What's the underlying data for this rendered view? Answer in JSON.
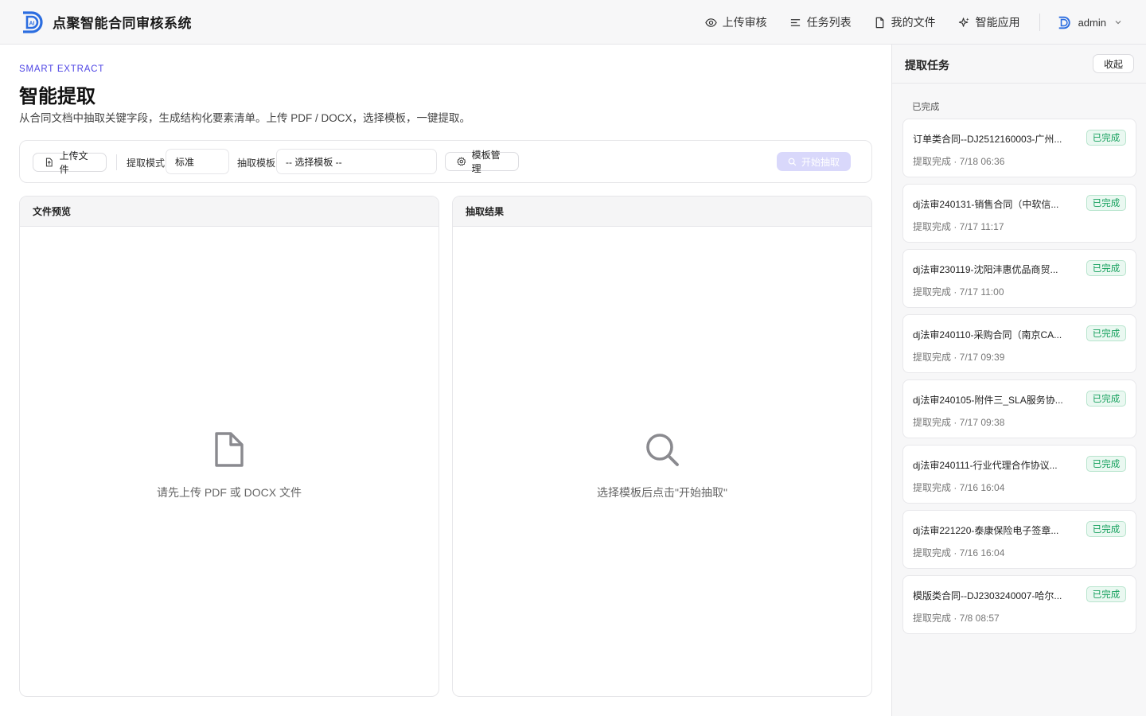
{
  "header": {
    "app_title": "点聚智能合同审核系统",
    "nav": [
      {
        "label": "上传审核",
        "icon": "eye-icon"
      },
      {
        "label": "任务列表",
        "icon": "list-icon"
      },
      {
        "label": "我的文件",
        "icon": "file-icon"
      },
      {
        "label": "智能应用",
        "icon": "sparkle-icon"
      }
    ],
    "user": {
      "name": "admin"
    }
  },
  "page": {
    "eyebrow": "SMART EXTRACT",
    "title": "智能提取",
    "description": "从合同文档中抽取关键字段，生成结构化要素清单。上传 PDF / DOCX，选择模板，一键提取。"
  },
  "toolbar": {
    "upload_label": "上传文件",
    "mode_label": "提取模式",
    "mode_value": "标准",
    "template_label": "抽取模板",
    "template_value": "-- 选择模板 --",
    "template_manage_label": "模板管理",
    "start_label": "开始抽取"
  },
  "panels": {
    "preview": {
      "title": "文件预览",
      "empty_text": "请先上传 PDF 或 DOCX 文件"
    },
    "result": {
      "title": "抽取结果",
      "empty_text": "选择模板后点击\"开始抽取\""
    }
  },
  "sidebar": {
    "title": "提取任务",
    "collapse_label": "收起",
    "group_label": "已完成",
    "tasks": [
      {
        "name": "订单类合同--DJ2512160003-广州...",
        "meta": "提取完成 · 7/18 06:36",
        "status": "已完成"
      },
      {
        "name": "dj法审240131-销售合同（中软信...",
        "meta": "提取完成 · 7/17 11:17",
        "status": "已完成"
      },
      {
        "name": "dj法审230119-沈阳沣惠优品商贸...",
        "meta": "提取完成 · 7/17 11:00",
        "status": "已完成"
      },
      {
        "name": "dj法审240110-采购合同（南京CA...",
        "meta": "提取完成 · 7/17 09:39",
        "status": "已完成"
      },
      {
        "name": "dj法审240105-附件三_SLA服务协...",
        "meta": "提取完成 · 7/17 09:38",
        "status": "已完成"
      },
      {
        "name": "dj法审240111-行业代理合作协议...",
        "meta": "提取完成 · 7/16 16:04",
        "status": "已完成"
      },
      {
        "name": "dj法审221220-泰康保险电子签章...",
        "meta": "提取完成 · 7/16 16:04",
        "status": "已完成"
      },
      {
        "name": "模版类合同--DJ2303240007-哈尔...",
        "meta": "提取完成 · 7/8 08:57",
        "status": "已完成"
      }
    ]
  },
  "colors": {
    "accent": "#4f46e5",
    "success": "#14a05c",
    "start_disabled": "#d9d8fb"
  }
}
